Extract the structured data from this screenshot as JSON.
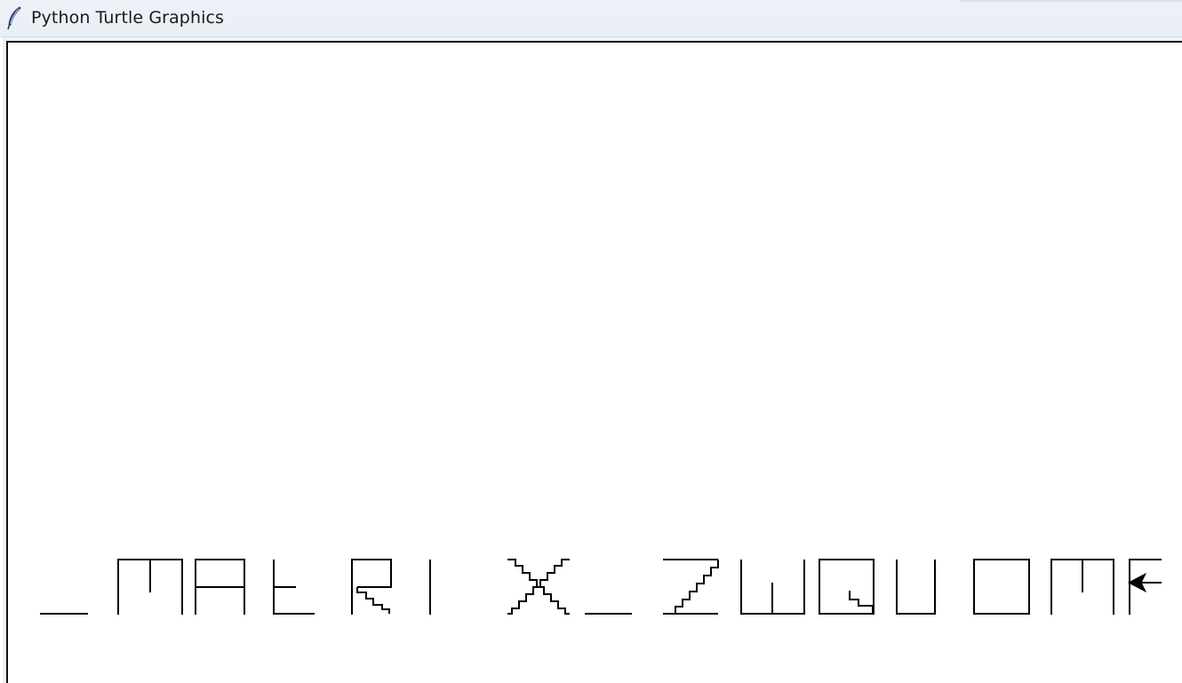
{
  "window": {
    "title": "Python Turtle Graphics",
    "icon": "feather-icon"
  },
  "canvas": {
    "background": "#ffffff",
    "pen_color": "#000000",
    "drawn_glyphs": [
      "_",
      "M",
      "A",
      "t",
      "R",
      "I",
      "X",
      "_",
      "Z",
      "W",
      "Q",
      "U",
      "O",
      "M",
      "F"
    ],
    "turtle_cursor": "arrow-cursor-icon"
  }
}
